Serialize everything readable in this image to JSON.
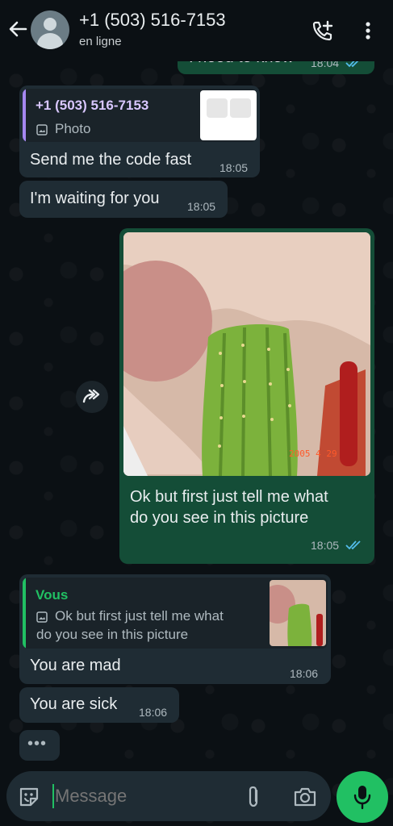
{
  "header": {
    "contact_name": "+1 (503) 516-7153",
    "status": "en ligne"
  },
  "messages": {
    "top_partial": {
      "text": "I need to know",
      "time": "18:04"
    },
    "reply1": {
      "quote_author": "+1 (503) 516-7153",
      "quote_type": "Photo",
      "text": "Send me the code fast",
      "time": "18:05"
    },
    "msg2": {
      "text": "I'm waiting for you",
      "time": "18:05"
    },
    "image_msg": {
      "photo_stamp": "2005  4  29",
      "text_line1": "Ok but first just tell me what",
      "text_line2": "do you see in this picture",
      "time": "18:05"
    },
    "reply2": {
      "quote_author": "Vous",
      "quote_line1": "Ok but first just tell me what",
      "quote_line2": "do you see in this picture",
      "text": "You are mad",
      "time": "18:06"
    },
    "msg4": {
      "text": "You are sick",
      "time": "18:06"
    },
    "typing": "•••"
  },
  "composer": {
    "placeholder": "Message"
  },
  "colors": {
    "background": "#0b1014",
    "incoming": "#1f2c34",
    "outgoing": "#144d37",
    "accent_green": "#21c063",
    "read_ticks": "#53bdeb",
    "quote_purple": "#a587f0",
    "quote_green": "#21c063"
  },
  "icons": [
    "back-arrow-icon",
    "avatar-icon",
    "add-call-icon",
    "more-vert-icon",
    "forward-icon",
    "photo-icon",
    "sticker-icon",
    "attach-icon",
    "camera-icon",
    "mic-icon",
    "double-check-icon"
  ]
}
